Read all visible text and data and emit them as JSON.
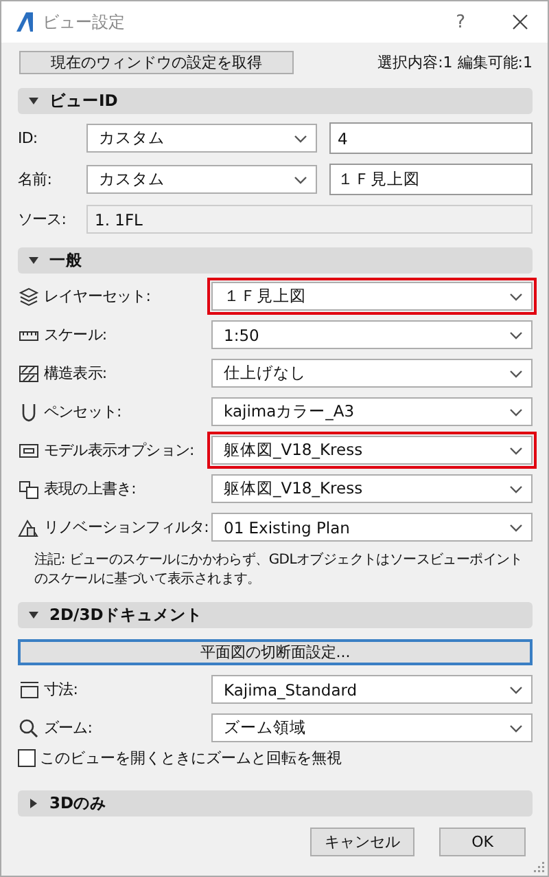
{
  "window": {
    "title": "ビュー設定",
    "help": "?"
  },
  "toolbar": {
    "button": "現在のウィンドウの設定を取得",
    "status": "選択内容:1 編集可能:1"
  },
  "sections": [
    {
      "title": "ビューID",
      "expanded": true,
      "rows": [
        {
          "kind": "pair",
          "label": "ID:",
          "select": "カスタム",
          "value": "4"
        },
        {
          "kind": "pair",
          "label": "名前:",
          "select": "カスタム",
          "value": "１Ｆ見上図"
        },
        {
          "kind": "readonly",
          "label": "ソース:",
          "value": "1. 1FL"
        }
      ]
    },
    {
      "title": "一般",
      "expanded": true,
      "rows": [
        {
          "kind": "select",
          "label": "レイヤーセット:",
          "value": "１Ｆ見上図",
          "highlighted": true
        },
        {
          "kind": "select",
          "label": "スケール:",
          "value": "1:50",
          "highlighted": false
        },
        {
          "kind": "select",
          "label": "構造表示:",
          "value": "仕上げなし",
          "highlighted": false
        },
        {
          "kind": "select",
          "label": "ペンセット:",
          "value": "kajimaカラー_A3",
          "highlighted": false
        },
        {
          "kind": "select",
          "label": "モデル表示オプション:",
          "value": "躯体図_V18_Kress",
          "highlighted": true
        },
        {
          "kind": "select",
          "label": "表現の上書き:",
          "value": "躯体図_V18_Kress",
          "highlighted": false
        },
        {
          "kind": "select",
          "label": "リノベーションフィルタ:",
          "value": "01 Existing Plan",
          "highlighted": false
        },
        {
          "kind": "note",
          "text": "注記: ビューのスケールにかかわらず、GDLオブジェクトはソースビューポイントのスケールに基づいて表示されます。"
        }
      ]
    },
    {
      "title": "2D/3Dドキュメント",
      "expanded": true,
      "rows": [
        {
          "kind": "button",
          "label": "平面図の切断面設定..."
        },
        {
          "kind": "select",
          "label": "寸法:",
          "value": "Kajima_Standard",
          "highlighted": false
        },
        {
          "kind": "select",
          "label": "ズーム:",
          "value": "ズーム領域",
          "highlighted": false
        },
        {
          "kind": "checkbox",
          "label": "このビューを開くときにズームと回転を無視",
          "checked": false
        }
      ]
    },
    {
      "title": "3Dのみ",
      "expanded": false
    }
  ],
  "buttons": [
    {
      "label": "キャンセル"
    },
    {
      "label": "OK"
    }
  ]
}
